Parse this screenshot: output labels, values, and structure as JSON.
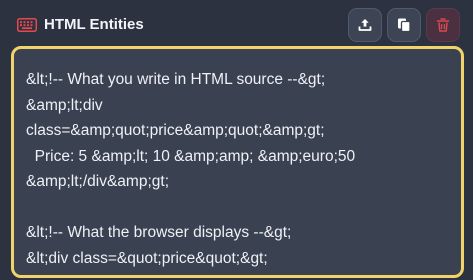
{
  "header": {
    "title": "HTML Entities",
    "icon": "keyboard-icon",
    "accent_color": "#e5484d"
  },
  "toolbar": {
    "upload_icon": "upload-icon",
    "copy_icon": "copy-icon",
    "delete_icon": "trash-icon"
  },
  "editor": {
    "border_color": "#f2d36b",
    "content": "&lt;!-- What you write in HTML source --&gt;\n&amp;lt;div\nclass=&amp;quot;price&amp;quot;&amp;gt;\n  Price: 5 &amp;lt; 10 &amp;amp; &amp;euro;50\n&amp;lt;/div&amp;gt;\n\n&lt;!-- What the browser displays --&gt;\n&lt;div class=&quot;price&quot;&gt;"
  }
}
